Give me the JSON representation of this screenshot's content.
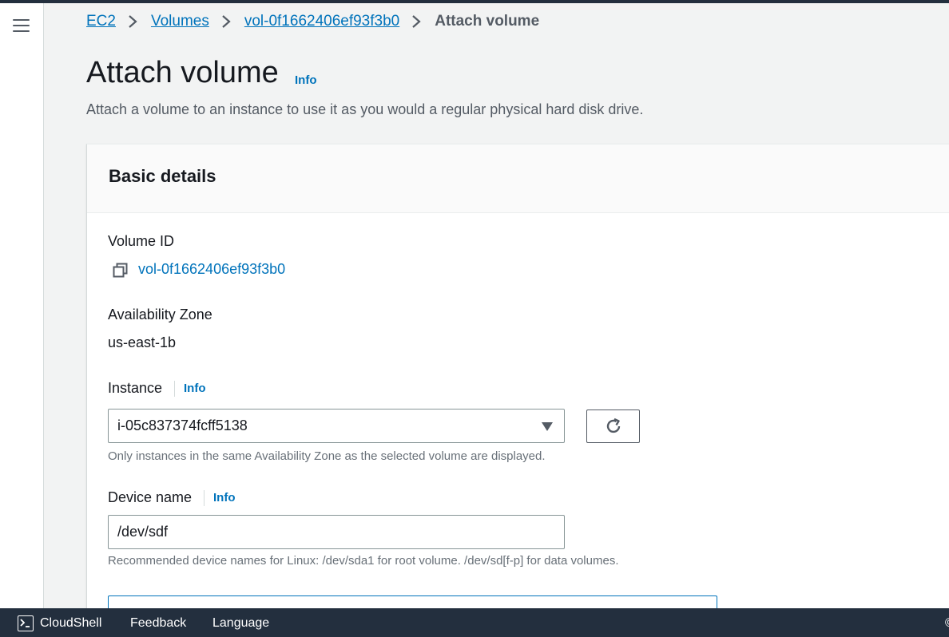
{
  "breadcrumb": {
    "items": [
      "EC2",
      "Volumes",
      "vol-0f1662406ef93f3b0"
    ],
    "current": "Attach volume"
  },
  "page": {
    "title": "Attach volume",
    "title_info": "Info",
    "description": "Attach a volume to an instance to use it as you would a regular physical hard disk drive."
  },
  "panel": {
    "title": "Basic details",
    "volume_id_label": "Volume ID",
    "volume_id_value": "vol-0f1662406ef93f3b0",
    "az_label": "Availability Zone",
    "az_value": "us-east-1b",
    "instance_label": "Instance",
    "instance_info": "Info",
    "instance_value": "i-05c837374fcff5138",
    "instance_hint": "Only instances in the same Availability Zone as the selected volume are displayed.",
    "device_label": "Device name",
    "device_info": "Info",
    "device_value": "/dev/sdf",
    "device_hint": "Recommended device names for Linux: /dev/sda1 for root volume. /dev/sd[f-p] for data volumes."
  },
  "footer": {
    "cloudshell": "CloudShell",
    "feedback": "Feedback",
    "language": "Language",
    "edge_text": "©"
  },
  "icons": {
    "menu": "hamburger-menu-icon",
    "copy": "copy-icon",
    "refresh": "refresh-icon",
    "dropdown": "caret-down-icon",
    "cloudshell": "cloudshell-icon",
    "breadcrumb_separator": "chevron-right-icon"
  },
  "colors": {
    "link": "#0073bb",
    "footer_bg": "#232f3e",
    "page_bg": "#f2f3f3"
  }
}
